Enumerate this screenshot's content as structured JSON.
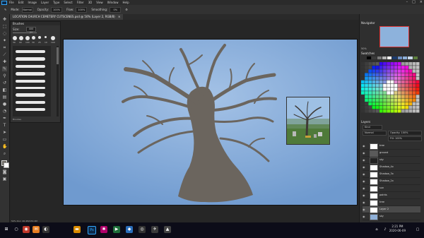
{
  "app": {
    "logo_text": "Ps"
  },
  "menubar": [
    "File",
    "Edit",
    "Image",
    "Layer",
    "Type",
    "Select",
    "Filter",
    "3D",
    "View",
    "Window",
    "Help"
  ],
  "window_controls": [
    "–",
    "□",
    "×"
  ],
  "options_bar": {
    "mode_label": "Mode:",
    "mode_value": "Normal",
    "opacity_label": "Opacity:",
    "opacity_value": "100%",
    "flow_label": "Flow:",
    "flow_value": "100%",
    "smoothing_label": "Smoothing:",
    "smoothing_value": "0%"
  },
  "document_tab": {
    "title": "LOCATION CHURCH CEMETERY CUTSCENES.psd @ 50% (Layer 2, RGB/8)",
    "close": "×"
  },
  "brushes_panel": {
    "title": "Brushes",
    "size_label": "Size:",
    "size_value": "400 px",
    "tip_labels": [
      "30",
      "90",
      "100",
      "30",
      "25",
      "10",
      "100"
    ],
    "footer": "Brushes"
  },
  "navigator": {
    "tab": "Navigator",
    "zoom": "50%"
  },
  "swatches": {
    "tab": "Swatches",
    "row": [
      "#000000",
      "#3a3a3a",
      "#7a7a7a",
      "#b4b4b4",
      "#ffffff",
      "#1c3b6e",
      "#6e90c4",
      "#8fb0d8",
      "#c9d8ea",
      "#5c7e3c"
    ]
  },
  "layers_panel": {
    "tab": "Layers",
    "kind_filter": "Kind",
    "blend_mode": "Normal",
    "opacity_label": "Opacity: 100%",
    "fill_label": "Fill: 100%",
    "layers": [
      {
        "name": "tree",
        "selected": false,
        "thumb": "#ffffff"
      },
      {
        "name": "ground",
        "selected": false,
        "thumb": "#5a5a5a"
      },
      {
        "name": "sky",
        "selected": false,
        "thumb": "#222222"
      },
      {
        "name": "Shadow_4x",
        "selected": false,
        "thumb": "#ffffff"
      },
      {
        "name": "Shadow_3x",
        "selected": false,
        "thumb": "#ffffff"
      },
      {
        "name": "Shadow_2x",
        "selected": false,
        "thumb": "#ffffff"
      },
      {
        "name": "sun",
        "selected": false,
        "thumb": "#ffffff"
      },
      {
        "name": "paints",
        "selected": false,
        "thumb": "#ffffff"
      },
      {
        "name": "tree",
        "selected": false,
        "thumb": "#ffffff"
      },
      {
        "name": "Layer 2",
        "selected": true,
        "thumb": "#ffffff"
      },
      {
        "name": "sky",
        "selected": false,
        "thumb": "#8fb0d8"
      }
    ]
  },
  "doc_info": "50%    Doc: 26.4M/153.4M",
  "taskbar": {
    "time": "2:21 PM",
    "date": "2020-06-09"
  },
  "colors": {
    "sky": "#7fa7d7",
    "tree": "#6b655e",
    "accent": "#31a8ff"
  }
}
